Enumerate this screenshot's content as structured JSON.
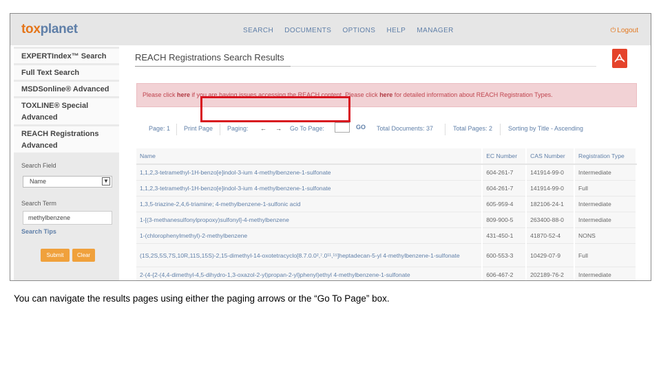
{
  "header": {
    "logo_tox": "tox",
    "logo_planet": "planet",
    "nav": [
      "SEARCH",
      "DOCUMENTS",
      "OPTIONS",
      "HELP",
      "MANAGER"
    ],
    "logout": "Logout",
    "logout_icon": "power-icon"
  },
  "sidebar": {
    "items": [
      "EXPERTIndex™ Search",
      "Full Text Search",
      "MSDSonline® Advanced",
      "TOXLINE® Special Advanced",
      "REACH Registrations Advanced"
    ],
    "search_field_label": "Search Field",
    "search_field_value": "Name",
    "search_term_label": "Search Term",
    "search_term_value": "methylbenzene",
    "search_tips": "Search Tips",
    "submit": "Submit",
    "clear": "Clear"
  },
  "main": {
    "title": "REACH Registrations Search Results",
    "pdf_icon": "pdf-icon",
    "alert": {
      "p1": "Please click ",
      "link1": "here",
      "p2": " if you are having issues accessing the REACH content. Please click ",
      "link2": "here",
      "p3": " for detailed information about REACH Registration Types."
    },
    "pager": {
      "page": "Page: 1",
      "print": "Print Page",
      "paging": "Paging:",
      "prev": "←",
      "next": "→",
      "goto": "Go To Page:",
      "go": "GO",
      "total_docs": "Total  Documents: 37",
      "total_pages": "Total Pages: 2",
      "sorting": "Sorting by Title - Ascending"
    },
    "table": {
      "headers": [
        "Name",
        "EC Number",
        "CAS Number",
        "Registration Type"
      ],
      "rows": [
        {
          "name": "1,1,2,3-tetramethyl-1H-benzo[e]indol-3-ium 4-methylbenzene-1-sulfonate",
          "ec": "604-261-7",
          "cas": "141914-99-0",
          "type": "Intermediate"
        },
        {
          "name": "1,1,2,3-tetramethyl-1H-benzo[e]indol-3-ium 4-methylbenzene-1-sulfonate",
          "ec": "604-261-7",
          "cas": "141914-99-0",
          "type": "Full"
        },
        {
          "name": "1,3,5-triazine-2,4,6-triamine; 4-methylbenzene-1-sulfonic acid",
          "ec": "605-959-4",
          "cas": "182106-24-1",
          "type": "Intermediate"
        },
        {
          "name": "1-[(3-methanesulfonylpropoxy)sulfonyl]-4-methylbenzene",
          "ec": "809-900-5",
          "cas": "263400-88-0",
          "type": "Intermediate"
        },
        {
          "name": "1-(chlorophenylmethyl)-2-methylbenzene",
          "ec": "431-450-1",
          "cas": "41870-52-4",
          "type": "NONS"
        },
        {
          "name": "(1S,2S,5S,7S,10R,11S,15S)-2,15-dimethyl-14-oxotetracyclo[8.7.0.0²,⁷.0¹¹,¹⁵]heptadecan-5-yl 4-methylbenzene-1-sulfonate",
          "ec": "600-553-3",
          "cas": "10429-07-9",
          "type": "Full"
        },
        {
          "name": "2-(4-{2-(4,4-dimethyl-4,5-dihydro-1,3-oxazol-2-yl)propan-2-yl}phenyl)ethyl 4-methylbenzene-1-sulfonate",
          "ec": "606-467-2",
          "cas": "202189-76-2",
          "type": "Intermediate"
        }
      ]
    }
  },
  "caption": "You can navigate the results pages using either the paging arrows or the “Go To Page” box.",
  "colors": {
    "brand_orange": "#e4761b",
    "link_blue": "#5f7fa8",
    "highlight_red": "#d8121e",
    "alert_bg": "#f2d2d5"
  }
}
